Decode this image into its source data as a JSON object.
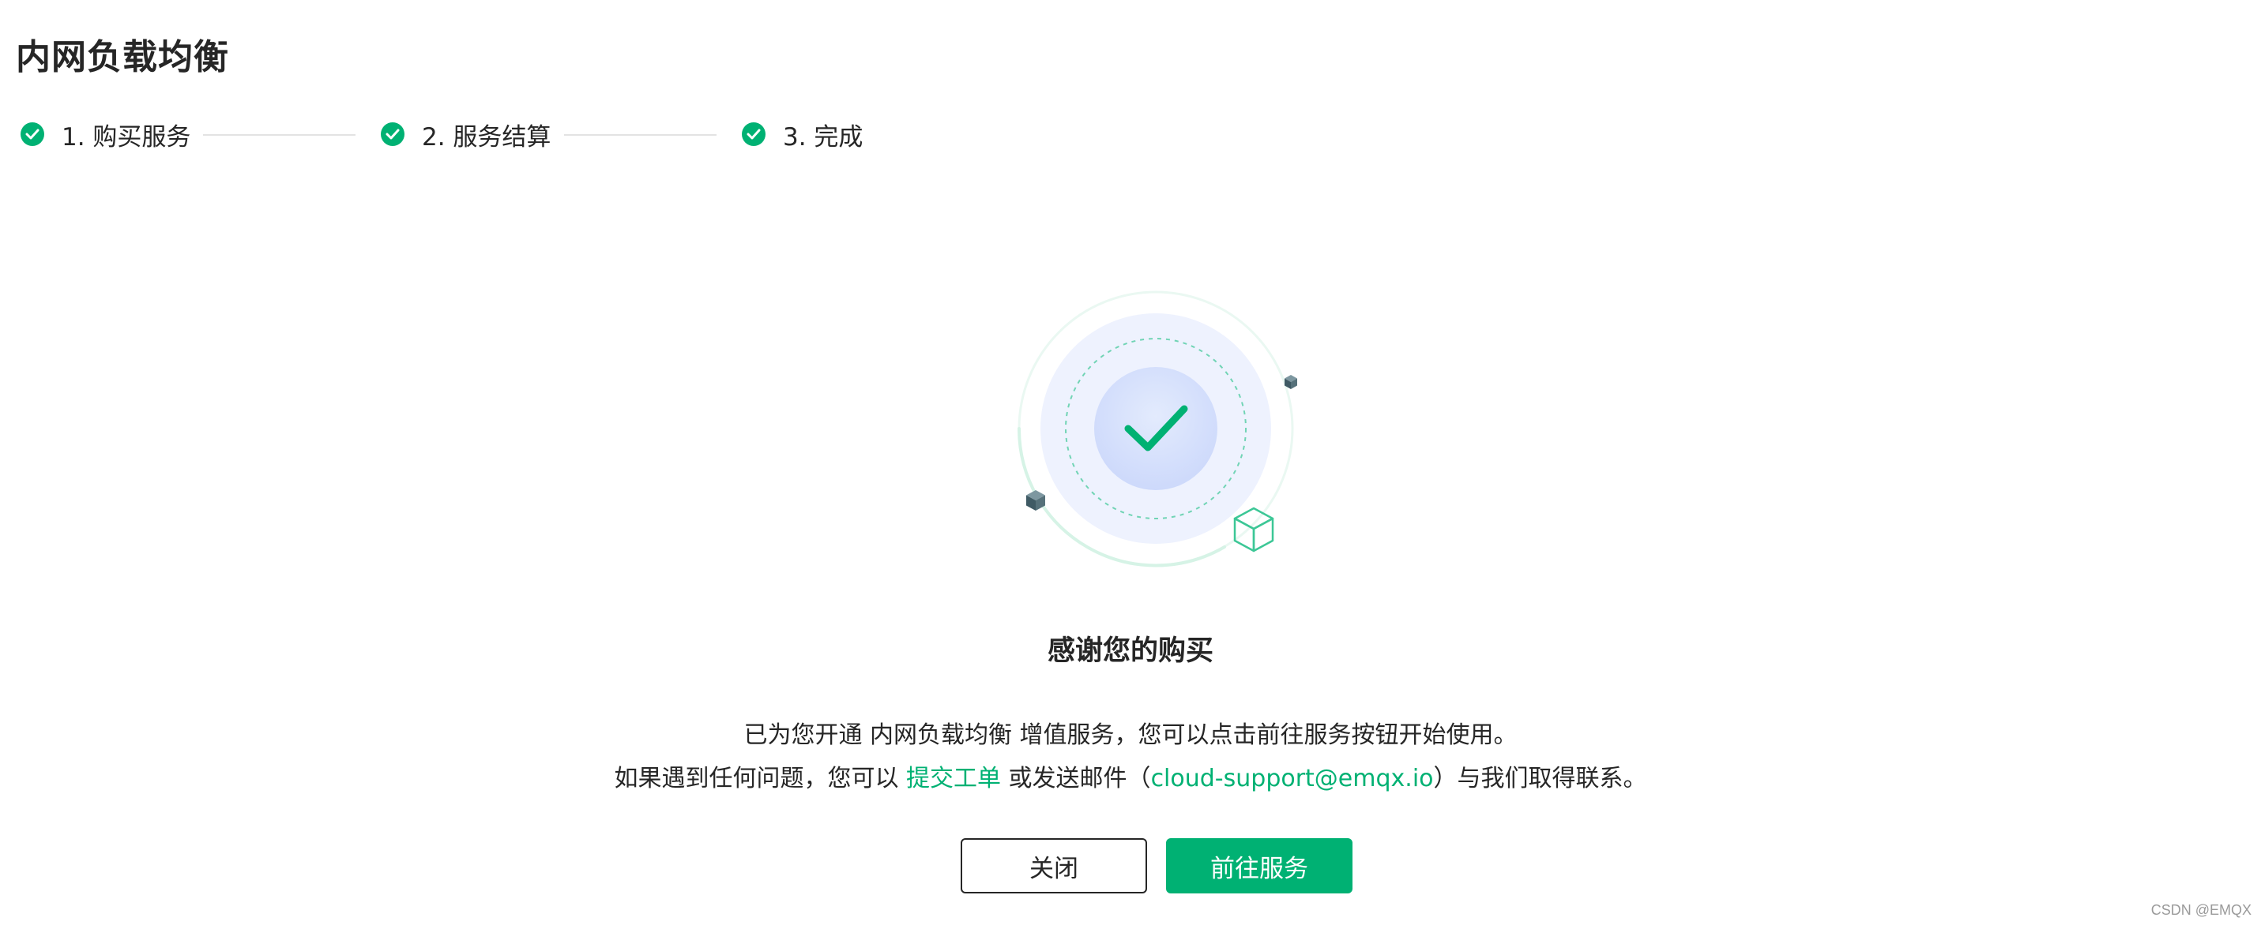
{
  "page": {
    "title": "内网负载均衡"
  },
  "steps": [
    {
      "label": "1. 购买服务",
      "status": "done"
    },
    {
      "label": "2. 服务结算",
      "status": "done"
    },
    {
      "label": "3. 完成",
      "status": "done"
    }
  ],
  "result": {
    "title": "感谢您的购买",
    "line1": "已为您开通 内网负载均衡 增值服务，您可以点击前往服务按钮开始使用。",
    "line2_prefix": "如果遇到任何问题，您可以 ",
    "ticket_link": "提交工单",
    "line2_middle": " 或发送邮件（",
    "email_link": "cloud-support@emqx.io",
    "line2_suffix": "）与我们取得联系。"
  },
  "buttons": {
    "close_label": "关闭",
    "go_label": "前往服务"
  },
  "watermark": "CSDN @EMQX",
  "colors": {
    "accent": "#00b173",
    "text": "#262626",
    "divider": "#e3e3e3"
  },
  "icons": {
    "step_status": "check-circle-icon",
    "illustration": "success-check-icon",
    "cubes": [
      "cube-icon",
      "cube-outline-icon"
    ]
  }
}
